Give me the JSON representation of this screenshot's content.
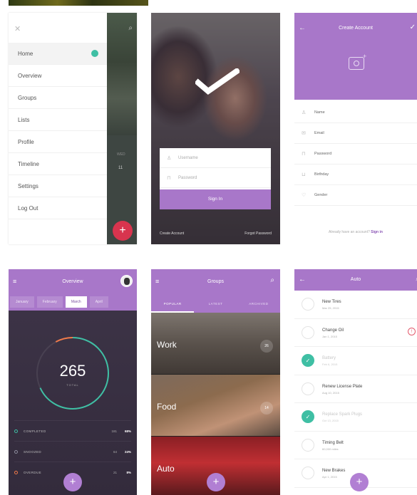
{
  "drawer": {
    "menu": [
      "Home",
      "Overview",
      "Groups",
      "Lists",
      "Profile",
      "Timeline",
      "Settings",
      "Log Out"
    ],
    "home_badge": "",
    "peek_day": "WED",
    "peek_num": "11",
    "fab": "+"
  },
  "login": {
    "username_placeholder": "Username",
    "password_placeholder": "Password",
    "signin": "Sign In",
    "create_account": "Create Account",
    "forgot_password": "Forgot Password"
  },
  "create_account": {
    "title": "Create Account",
    "fields": [
      "Name",
      "Email",
      "Password",
      "Birthday",
      "Gender"
    ],
    "login_prompt": "Already have an account?",
    "login_link": "Sign in"
  },
  "overview": {
    "title": "Overview",
    "tabs": [
      "January",
      "February",
      "March",
      "April"
    ],
    "selected_tab": "March",
    "total": "265",
    "total_label": "TOTAL",
    "legend": [
      {
        "name": "COMPLETED",
        "count": "181",
        "pct": "68%",
        "color": "#3fbfa4"
      },
      {
        "name": "SNOOZED",
        "count": "64",
        "pct": "24%",
        "color": "#8c8c9c"
      },
      {
        "name": "OVERDUE",
        "count": "21",
        "pct": "8%",
        "color": "#f07a4a"
      }
    ],
    "fab": "+"
  },
  "groups": {
    "title": "Groups",
    "tabs": [
      "POPULAR",
      "LATEST",
      "ARCHIVED"
    ],
    "selected_tab": "POPULAR",
    "items": [
      {
        "label": "Work",
        "count": "26"
      },
      {
        "label": "Food",
        "count": "14"
      },
      {
        "label": "Auto",
        "count": ""
      }
    ],
    "fab": "+"
  },
  "auto": {
    "title": "Auto",
    "tasks": [
      {
        "title": "New Tires",
        "sub": "Mar 25, 2015",
        "done": false,
        "warn": false
      },
      {
        "title": "Change Oil",
        "sub": "Jan 1, 2015",
        "done": false,
        "warn": true
      },
      {
        "title": "Battery",
        "sub": "Feb 6, 2015",
        "done": true,
        "warn": false
      },
      {
        "title": "Renew License Plate",
        "sub": "Aug 10, 2015",
        "done": false,
        "warn": false
      },
      {
        "title": "Replace Spark Plugs",
        "sub": "Oct 13, 2015",
        "done": true,
        "warn": false
      },
      {
        "title": "Timing Belt",
        "sub": "60,000 miles",
        "done": false,
        "warn": false
      },
      {
        "title": "New Brakes",
        "sub": "Apr 1, 2015",
        "done": false,
        "warn": false
      }
    ],
    "fab": "+"
  }
}
